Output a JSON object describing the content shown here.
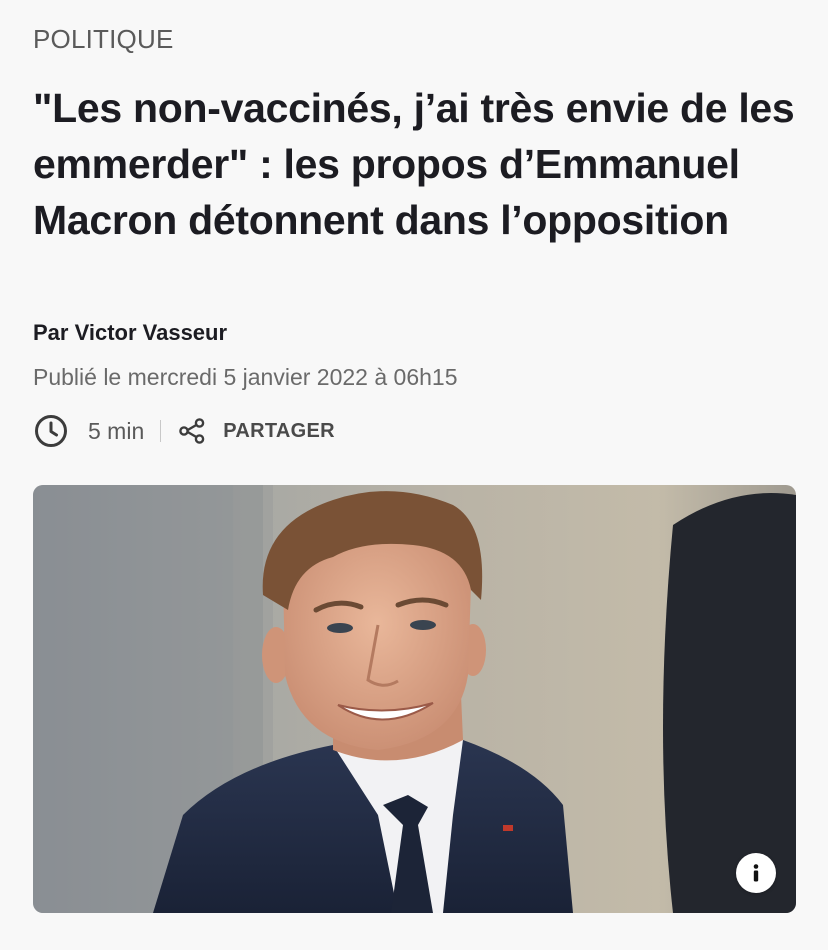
{
  "article": {
    "section": "POLITIQUE",
    "headline": "\"Les non-vaccinés, j’ai très envie de les emmerder\" : les propos d’Emmanuel Macron détonnent dans l’opposition",
    "byline": "Par Victor Vasseur",
    "published": "Publié le mercredi 5 janvier 2022 à 06h15",
    "read_time": "5 min",
    "share_label": "PARTAGER"
  },
  "icons": {
    "clock": "clock-icon",
    "share": "share-icon",
    "info": "info-icon"
  },
  "colors": {
    "background": "#f8f8f8",
    "headline": "#1c1c22",
    "muted": "#6a6a6a"
  }
}
